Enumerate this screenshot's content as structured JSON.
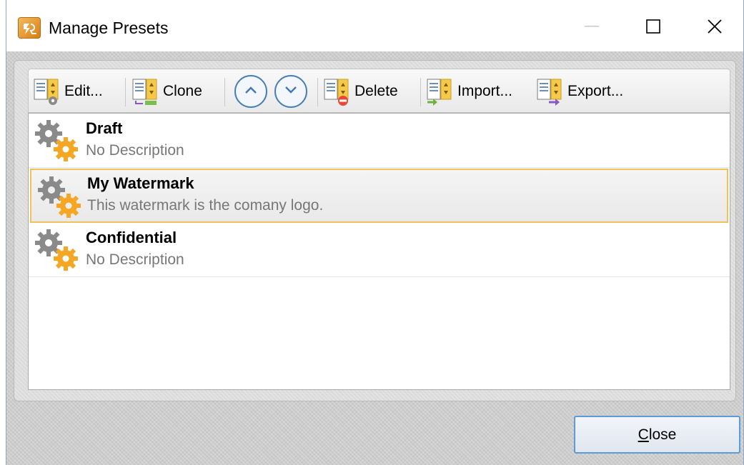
{
  "window": {
    "title": "Manage Presets"
  },
  "toolbar": {
    "edit_label": "Edit...",
    "clone_label": "Clone",
    "delete_label": "Delete",
    "import_label": "Import...",
    "export_label": "Export..."
  },
  "presets": [
    {
      "name": "Draft",
      "description": "No Description",
      "selected": false
    },
    {
      "name": "My Watermark",
      "description": "This watermark is the comany logo.",
      "selected": true
    },
    {
      "name": "Confidential",
      "description": "No Description",
      "selected": false
    }
  ],
  "footer": {
    "close_first": "C",
    "close_rest": "lose"
  },
  "colors": {
    "accent": "#4a7fb5",
    "selection_border": "#f2c25a",
    "gear_gray": "#8a8a8a",
    "gear_orange": "#f5a623"
  },
  "icons": {
    "edit": "document-gear-icon",
    "clone": "document-clone-icon",
    "move_up": "chevron-up-circle-icon",
    "move_down": "chevron-down-circle-icon",
    "delete": "document-delete-icon",
    "import": "document-import-icon",
    "export": "document-export-icon",
    "preset": "gears-icon"
  }
}
